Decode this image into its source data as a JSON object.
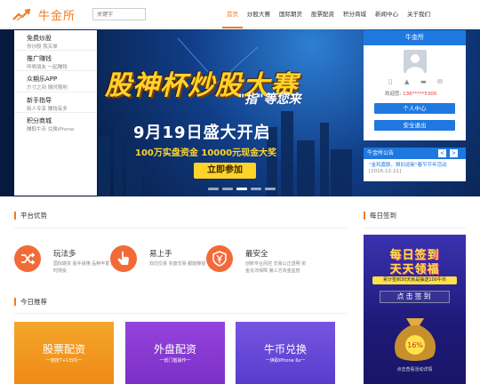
{
  "header": {
    "logo_text": "牛金所",
    "search_placeholder": "关键字",
    "nav": [
      "首页",
      "炒股大赛",
      "国际期货",
      "股票配资",
      "积分商城",
      "新闻中心",
      "关于我们"
    ],
    "accent": "#f07b22"
  },
  "menu": [
    {
      "title": "免费炒股",
      "desc": "你炒股 我买单"
    },
    {
      "title": "推广赚钱",
      "desc": "呼唤朋友 一起赚钱"
    },
    {
      "title": "众期乐APP",
      "desc": "方寸之间 随时随地"
    },
    {
      "title": "新手指导",
      "desc": "新人专享 赚钱有多"
    },
    {
      "title": "积分商城",
      "desc": "赚取牛币 兑换iPhone"
    }
  ],
  "banner": {
    "title": "股神杯炒股大赛",
    "subtitle": "\"指\"等您来",
    "date": "9月19日盛大开启",
    "prize": "100万实盘资金  10000元现金大奖",
    "join": "立即参加"
  },
  "user_panel": {
    "title": "牛金所",
    "phone_label": "欢迎您:",
    "phone": "136*****5300",
    "btn_center": "个人中心",
    "btn_logout": "安全退出"
  },
  "notice": {
    "title": "牛金所公告",
    "prev": "<",
    "next": ">",
    "text": "\"金鸡嘉豚，狮旧迎新\"春节节年活动",
    "date": "[2016-12-21]"
  },
  "advantages": {
    "title": "平台优势",
    "items": [
      {
        "title": "玩法多",
        "desc": "国际期货 股手易懂 品种丰富 随时随投"
      },
      {
        "title": "易上手",
        "desc": "双向交易 实盘交易 都能赚钱"
      },
      {
        "title": "最安全",
        "desc": "创新专业风控 交易公正透明 资金充沛保障 第三方资金监管"
      }
    ]
  },
  "today": {
    "title": "今日推荐",
    "cards": [
      {
        "title": "股票配资",
        "sub": "一按按T+1日内一",
        "color": "#f29a21"
      },
      {
        "title": "外盘配资",
        "sub": "一低门槛操作一",
        "color": "#8a3bd4"
      },
      {
        "title": "牛币兑换",
        "sub": "一换取iPhone 6s一",
        "color": "#6c4ad6"
      }
    ]
  },
  "daily": {
    "title": "每日签到",
    "line1": "每日签到",
    "line2": "天天领福",
    "strip": "累计签到30天就是抽送100牛币",
    "button": "点击签到",
    "link": "点击查看活动详情"
  }
}
